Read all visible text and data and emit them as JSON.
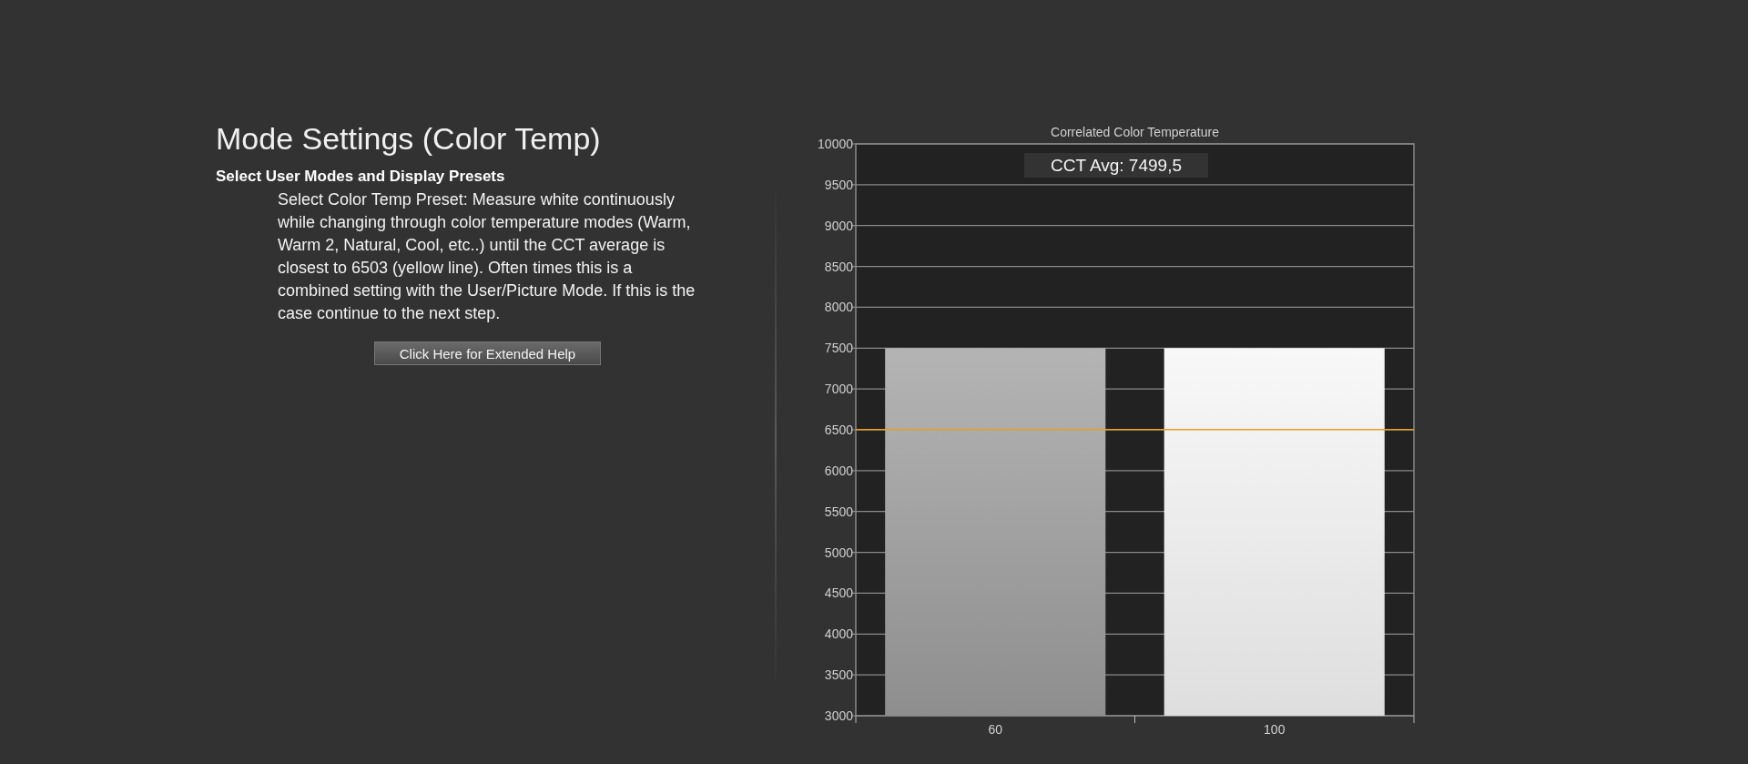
{
  "heading": "Mode Settings (Color Temp)",
  "subheading": "Select User Modes and Display Presets",
  "description": "Select Color Temp Preset: Measure white continuously while changing through color temperature modes (Warm, Warm 2, Natural, Cool, etc..) until the CCT average is closest to 6503 (yellow line). Often times this is a combined setting with the User/Picture Mode. If this is the case continue to the next step.",
  "help_button": "Click Here for Extended Help",
  "chart_data": {
    "type": "bar",
    "title": "Correlated Color Temperature",
    "categories": [
      "60",
      "100"
    ],
    "series": [
      {
        "values": [
          7500,
          7500
        ]
      }
    ],
    "grid": true,
    "ref_lines": [
      {
        "axis": "y",
        "value": 6503,
        "color": "#e8a020"
      }
    ],
    "ylim": [
      3000,
      10000
    ],
    "yticks": [
      3000,
      3500,
      4000,
      4500,
      5000,
      5500,
      6000,
      6500,
      7000,
      7500,
      8000,
      8500,
      9000,
      9500,
      10000
    ],
    "annotations": [
      {
        "text": "CCT Avg: 7499,5"
      }
    ]
  }
}
